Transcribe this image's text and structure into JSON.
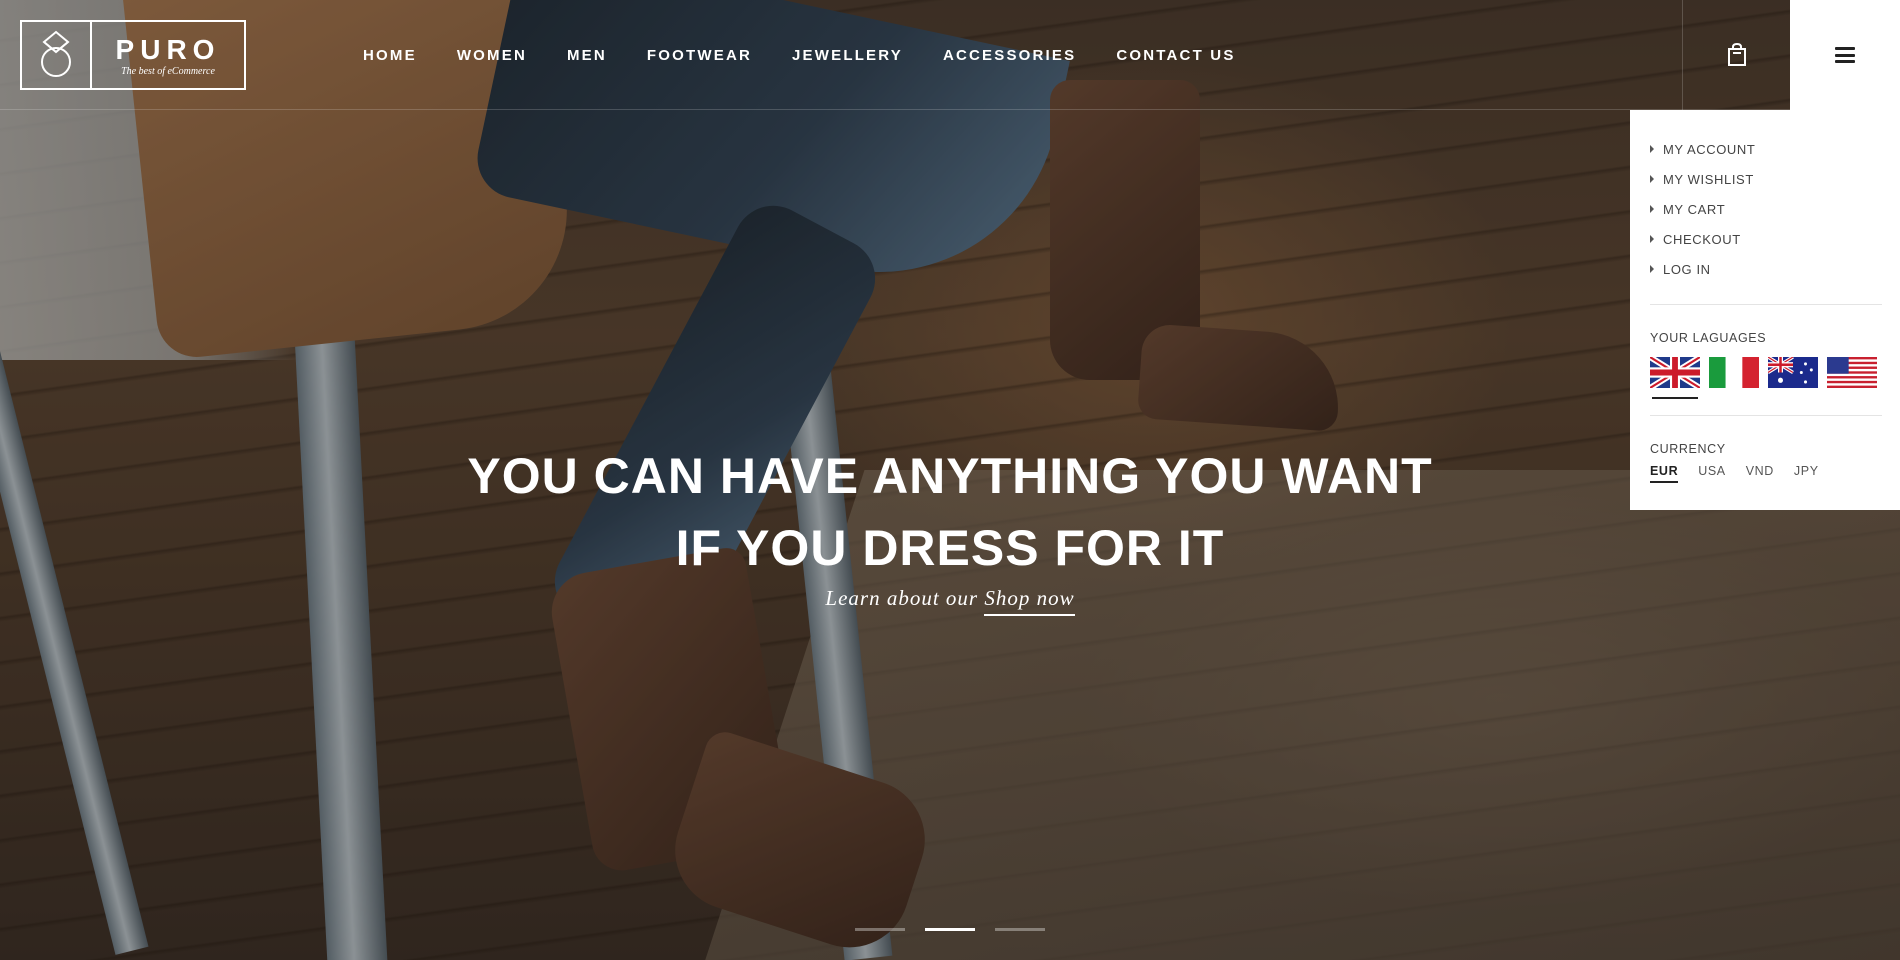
{
  "brand": {
    "name": "PURO",
    "tagline": "The best of eCommerce"
  },
  "nav": {
    "items": [
      {
        "label": "HOME"
      },
      {
        "label": "WOMEN"
      },
      {
        "label": "MEN"
      },
      {
        "label": "FOOTWEAR"
      },
      {
        "label": "JEWELLERY"
      },
      {
        "label": "ACCESSORIES"
      },
      {
        "label": "CONTACT US"
      }
    ]
  },
  "header_icons": {
    "cart": "shopping-bag-icon",
    "menu": "hamburger-menu-icon"
  },
  "panel": {
    "links": [
      {
        "label": "MY ACCOUNT"
      },
      {
        "label": "MY WISHLIST"
      },
      {
        "label": "MY CART"
      },
      {
        "label": "CHECKOUT"
      },
      {
        "label": "LOG IN"
      }
    ],
    "languages_heading": "YOUR LAGUAGES",
    "languages": [
      {
        "flag": "uk-flag-icon",
        "selected": true
      },
      {
        "flag": "italy-flag-icon",
        "selected": false
      },
      {
        "flag": "australia-flag-icon",
        "selected": false
      },
      {
        "flag": "usa-flag-icon",
        "selected": false
      }
    ],
    "currency_heading": "CURRENCY",
    "currencies": [
      {
        "label": "EUR",
        "selected": true
      },
      {
        "label": "USA",
        "selected": false
      },
      {
        "label": "VND",
        "selected": false
      },
      {
        "label": "JPY",
        "selected": false
      }
    ]
  },
  "hero": {
    "headline_line1": "YOU CAN HAVE ANYTHING YOU WANT",
    "headline_line2": "IF YOU DRESS FOR IT",
    "sub_prefix": "Learn about our",
    "sub_link": "Shop now"
  },
  "slider": {
    "count": 3,
    "active_index": 1
  },
  "colors": {
    "panel_bg": "#ffffff",
    "text_dark": "#222222",
    "hero_text": "#ffffff"
  }
}
